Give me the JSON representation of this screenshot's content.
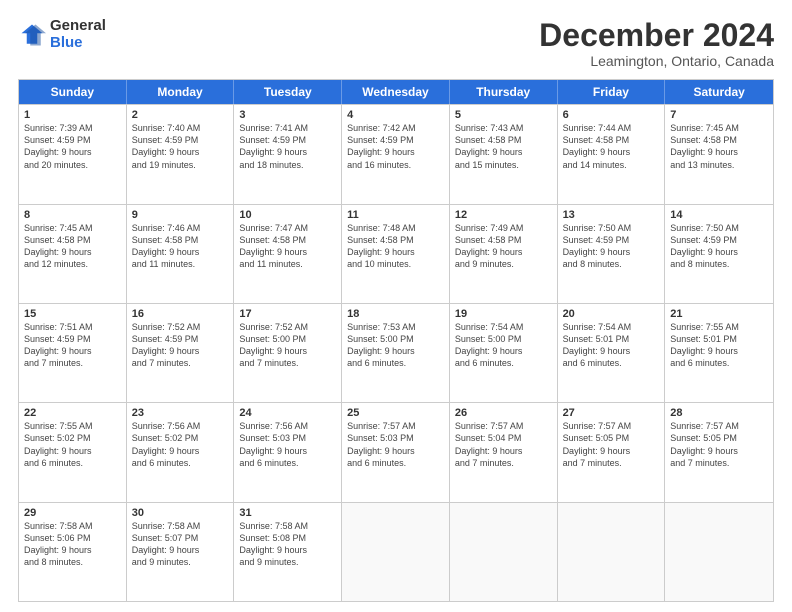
{
  "logo": {
    "general": "General",
    "blue": "Blue"
  },
  "title": "December 2024",
  "subtitle": "Leamington, Ontario, Canada",
  "days": [
    "Sunday",
    "Monday",
    "Tuesday",
    "Wednesday",
    "Thursday",
    "Friday",
    "Saturday"
  ],
  "rows": [
    [
      {
        "day": "1",
        "lines": [
          "Sunrise: 7:39 AM",
          "Sunset: 4:59 PM",
          "Daylight: 9 hours",
          "and 20 minutes."
        ]
      },
      {
        "day": "2",
        "lines": [
          "Sunrise: 7:40 AM",
          "Sunset: 4:59 PM",
          "Daylight: 9 hours",
          "and 19 minutes."
        ]
      },
      {
        "day": "3",
        "lines": [
          "Sunrise: 7:41 AM",
          "Sunset: 4:59 PM",
          "Daylight: 9 hours",
          "and 18 minutes."
        ]
      },
      {
        "day": "4",
        "lines": [
          "Sunrise: 7:42 AM",
          "Sunset: 4:59 PM",
          "Daylight: 9 hours",
          "and 16 minutes."
        ]
      },
      {
        "day": "5",
        "lines": [
          "Sunrise: 7:43 AM",
          "Sunset: 4:58 PM",
          "Daylight: 9 hours",
          "and 15 minutes."
        ]
      },
      {
        "day": "6",
        "lines": [
          "Sunrise: 7:44 AM",
          "Sunset: 4:58 PM",
          "Daylight: 9 hours",
          "and 14 minutes."
        ]
      },
      {
        "day": "7",
        "lines": [
          "Sunrise: 7:45 AM",
          "Sunset: 4:58 PM",
          "Daylight: 9 hours",
          "and 13 minutes."
        ]
      }
    ],
    [
      {
        "day": "8",
        "lines": [
          "Sunrise: 7:45 AM",
          "Sunset: 4:58 PM",
          "Daylight: 9 hours",
          "and 12 minutes."
        ]
      },
      {
        "day": "9",
        "lines": [
          "Sunrise: 7:46 AM",
          "Sunset: 4:58 PM",
          "Daylight: 9 hours",
          "and 11 minutes."
        ]
      },
      {
        "day": "10",
        "lines": [
          "Sunrise: 7:47 AM",
          "Sunset: 4:58 PM",
          "Daylight: 9 hours",
          "and 11 minutes."
        ]
      },
      {
        "day": "11",
        "lines": [
          "Sunrise: 7:48 AM",
          "Sunset: 4:58 PM",
          "Daylight: 9 hours",
          "and 10 minutes."
        ]
      },
      {
        "day": "12",
        "lines": [
          "Sunrise: 7:49 AM",
          "Sunset: 4:58 PM",
          "Daylight: 9 hours",
          "and 9 minutes."
        ]
      },
      {
        "day": "13",
        "lines": [
          "Sunrise: 7:50 AM",
          "Sunset: 4:59 PM",
          "Daylight: 9 hours",
          "and 8 minutes."
        ]
      },
      {
        "day": "14",
        "lines": [
          "Sunrise: 7:50 AM",
          "Sunset: 4:59 PM",
          "Daylight: 9 hours",
          "and 8 minutes."
        ]
      }
    ],
    [
      {
        "day": "15",
        "lines": [
          "Sunrise: 7:51 AM",
          "Sunset: 4:59 PM",
          "Daylight: 9 hours",
          "and 7 minutes."
        ]
      },
      {
        "day": "16",
        "lines": [
          "Sunrise: 7:52 AM",
          "Sunset: 4:59 PM",
          "Daylight: 9 hours",
          "and 7 minutes."
        ]
      },
      {
        "day": "17",
        "lines": [
          "Sunrise: 7:52 AM",
          "Sunset: 5:00 PM",
          "Daylight: 9 hours",
          "and 7 minutes."
        ]
      },
      {
        "day": "18",
        "lines": [
          "Sunrise: 7:53 AM",
          "Sunset: 5:00 PM",
          "Daylight: 9 hours",
          "and 6 minutes."
        ]
      },
      {
        "day": "19",
        "lines": [
          "Sunrise: 7:54 AM",
          "Sunset: 5:00 PM",
          "Daylight: 9 hours",
          "and 6 minutes."
        ]
      },
      {
        "day": "20",
        "lines": [
          "Sunrise: 7:54 AM",
          "Sunset: 5:01 PM",
          "Daylight: 9 hours",
          "and 6 minutes."
        ]
      },
      {
        "day": "21",
        "lines": [
          "Sunrise: 7:55 AM",
          "Sunset: 5:01 PM",
          "Daylight: 9 hours",
          "and 6 minutes."
        ]
      }
    ],
    [
      {
        "day": "22",
        "lines": [
          "Sunrise: 7:55 AM",
          "Sunset: 5:02 PM",
          "Daylight: 9 hours",
          "and 6 minutes."
        ]
      },
      {
        "day": "23",
        "lines": [
          "Sunrise: 7:56 AM",
          "Sunset: 5:02 PM",
          "Daylight: 9 hours",
          "and 6 minutes."
        ]
      },
      {
        "day": "24",
        "lines": [
          "Sunrise: 7:56 AM",
          "Sunset: 5:03 PM",
          "Daylight: 9 hours",
          "and 6 minutes."
        ]
      },
      {
        "day": "25",
        "lines": [
          "Sunrise: 7:57 AM",
          "Sunset: 5:03 PM",
          "Daylight: 9 hours",
          "and 6 minutes."
        ]
      },
      {
        "day": "26",
        "lines": [
          "Sunrise: 7:57 AM",
          "Sunset: 5:04 PM",
          "Daylight: 9 hours",
          "and 7 minutes."
        ]
      },
      {
        "day": "27",
        "lines": [
          "Sunrise: 7:57 AM",
          "Sunset: 5:05 PM",
          "Daylight: 9 hours",
          "and 7 minutes."
        ]
      },
      {
        "day": "28",
        "lines": [
          "Sunrise: 7:57 AM",
          "Sunset: 5:05 PM",
          "Daylight: 9 hours",
          "and 7 minutes."
        ]
      }
    ],
    [
      {
        "day": "29",
        "lines": [
          "Sunrise: 7:58 AM",
          "Sunset: 5:06 PM",
          "Daylight: 9 hours",
          "and 8 minutes."
        ]
      },
      {
        "day": "30",
        "lines": [
          "Sunrise: 7:58 AM",
          "Sunset: 5:07 PM",
          "Daylight: 9 hours",
          "and 9 minutes."
        ]
      },
      {
        "day": "31",
        "lines": [
          "Sunrise: 7:58 AM",
          "Sunset: 5:08 PM",
          "Daylight: 9 hours",
          "and 9 minutes."
        ]
      },
      {
        "day": "",
        "lines": []
      },
      {
        "day": "",
        "lines": []
      },
      {
        "day": "",
        "lines": []
      },
      {
        "day": "",
        "lines": []
      }
    ]
  ]
}
